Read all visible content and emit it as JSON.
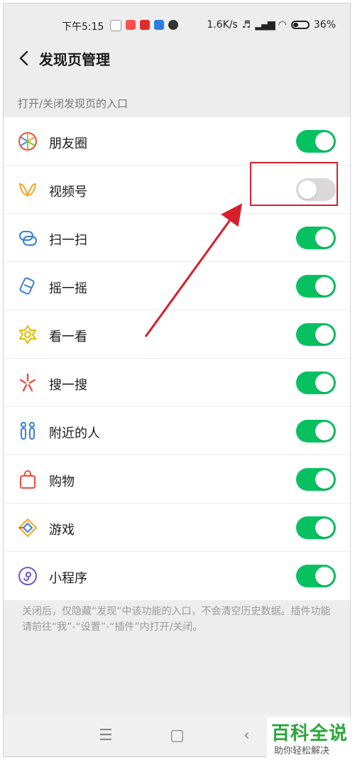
{
  "status_bar": {
    "time": "下午5:15",
    "network_speed": "1.6K/s",
    "battery_percent": "36%",
    "battery_level": 0.36
  },
  "header": {
    "title": "发现页管理"
  },
  "section_label": "打开/关闭发现页的入口",
  "items": [
    {
      "label": "朋友圈",
      "icon": "moments-icon",
      "enabled": true
    },
    {
      "label": "视频号",
      "icon": "channels-icon",
      "enabled": false
    },
    {
      "label": "扫一扫",
      "icon": "scan-icon",
      "enabled": true
    },
    {
      "label": "摇一摇",
      "icon": "shake-icon",
      "enabled": true
    },
    {
      "label": "看一看",
      "icon": "top-stories-icon",
      "enabled": true
    },
    {
      "label": "搜一搜",
      "icon": "search-icon",
      "enabled": true
    },
    {
      "label": "附近的人",
      "icon": "people-nearby-icon",
      "enabled": true
    },
    {
      "label": "购物",
      "icon": "shopping-bag-icon",
      "enabled": true
    },
    {
      "label": "游戏",
      "icon": "games-icon",
      "enabled": true
    },
    {
      "label": "小程序",
      "icon": "mini-programs-icon",
      "enabled": true
    }
  ],
  "footnote": "关闭后，仅隐藏“发现”中该功能的入口，不会清空历史数据。插件功能请前往“我”-“设置”-“插件”内打开/关闭。",
  "watermark": {
    "title": "百科全说",
    "subtitle": "助你轻松解决"
  },
  "colors": {
    "toggle_on": "#07c160",
    "toggle_off": "#d9d9d9",
    "highlight": "#d61f2a",
    "page_bg": "#ededed"
  }
}
